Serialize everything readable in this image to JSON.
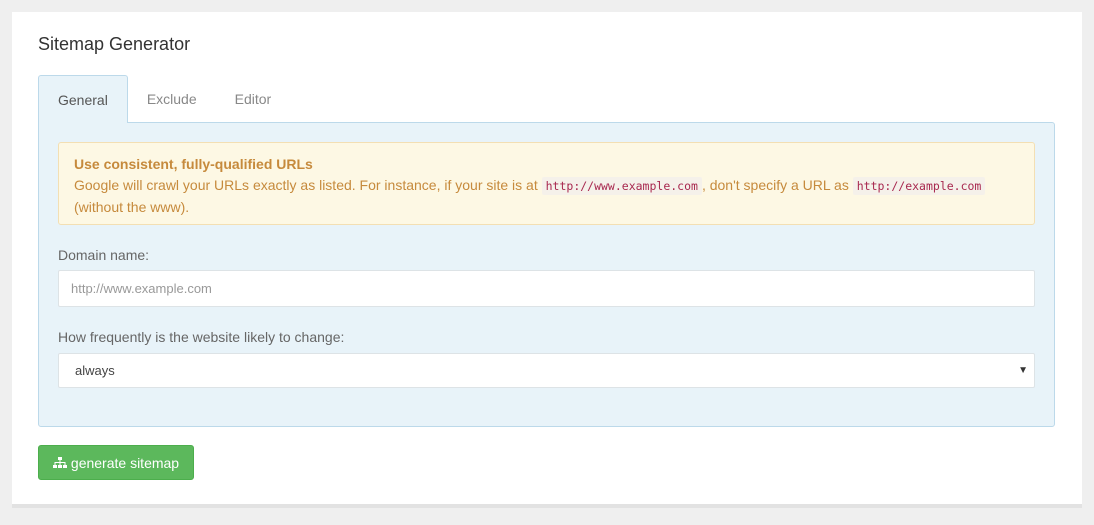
{
  "page": {
    "title": "Sitemap Generator"
  },
  "tabs": [
    {
      "label": "General",
      "active": true
    },
    {
      "label": "Exclude",
      "active": false
    },
    {
      "label": "Editor",
      "active": false
    }
  ],
  "alert": {
    "heading": "Use consistent, fully-qualified URLs",
    "text_1": "Google will crawl your URLs exactly as listed. For instance, if your site is at",
    "code_1": "http://www.example.com",
    "text_2": ", don't specify a URL as",
    "code_2": "http://example.com",
    "text_3": "(without the www)."
  },
  "form": {
    "domain_label": "Domain name:",
    "domain_placeholder": "http://www.example.com",
    "domain_value": "",
    "frequency_label": "How frequently is the website likely to change:",
    "frequency_selected": "always"
  },
  "actions": {
    "generate_label": "generate sitemap",
    "generate_icon": "sitemap-icon"
  },
  "colors": {
    "accent_button": "#5cb85c",
    "tab_panel_bg": "#e8f3f9",
    "alert_bg": "#fdf8e4",
    "alert_text": "#c68a3c"
  }
}
